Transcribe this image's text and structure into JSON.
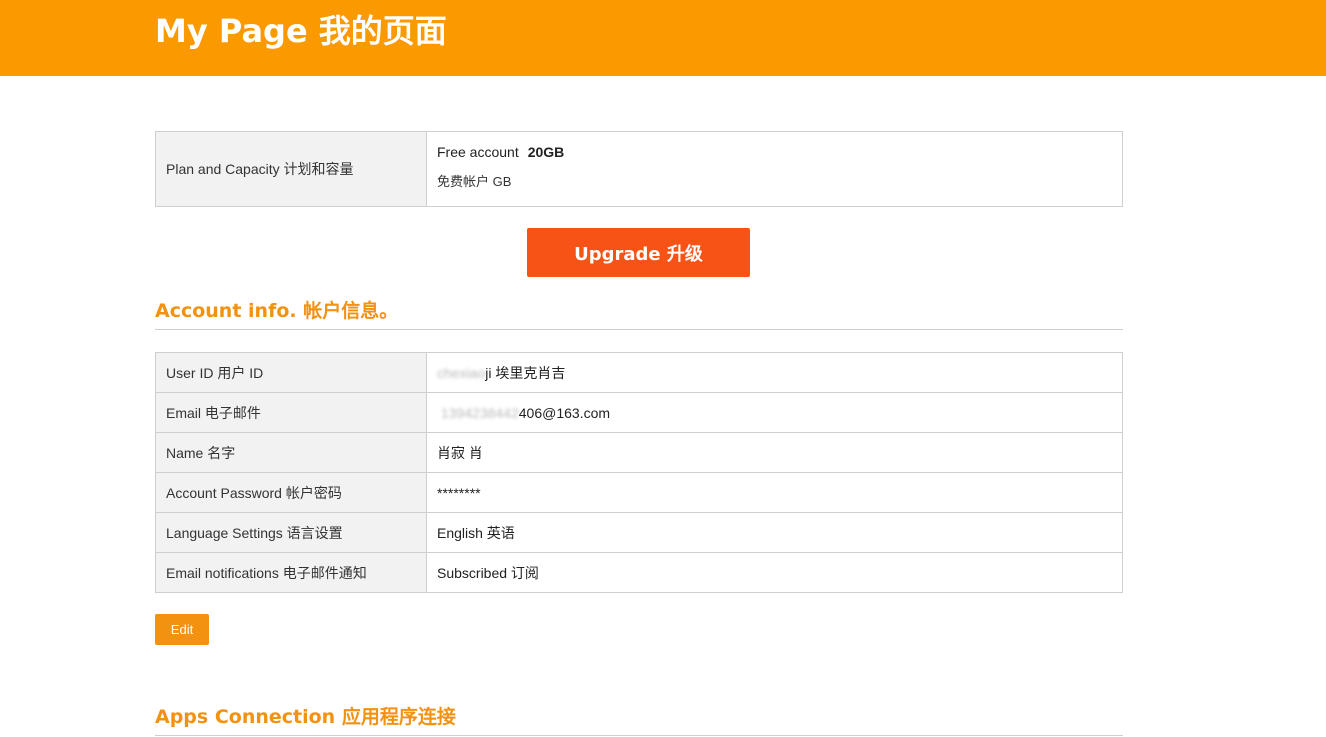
{
  "header": {
    "title": "My Page 我的页面"
  },
  "plan": {
    "label": "Plan and Capacity 计划和容量",
    "plan_name": "Free account",
    "capacity": "20GB",
    "plan_name_cn": "免费帐户 GB"
  },
  "upgrade_label": "Upgrade 升级",
  "account_section": {
    "title": "Account info. 帐户信息。",
    "rows": [
      {
        "label": "User ID 用户 ID",
        "value_hidden": "chexiao",
        "value": "ji 埃里克肖吉"
      },
      {
        "label": "Email 电子邮件",
        "value_hidden": " 1394238442",
        "value": "406@163.com"
      },
      {
        "label": "Name 名字",
        "value": "肖寂 肖"
      },
      {
        "label": "Account Password 帐户密码",
        "value": "********"
      },
      {
        "label": "Language Settings 语言设置",
        "value": "English 英语"
      },
      {
        "label": "Email notifications 电子邮件通知",
        "value": "Subscribed 订阅"
      }
    ],
    "edit_label": "Edit"
  },
  "apps_section": {
    "title": "Apps Connection 应用程序连接"
  },
  "colors": {
    "header_bg": "#fb9900",
    "upgrade_bg": "#f85316",
    "accent": "#f39211",
    "label_bg": "#f2f2f2"
  }
}
